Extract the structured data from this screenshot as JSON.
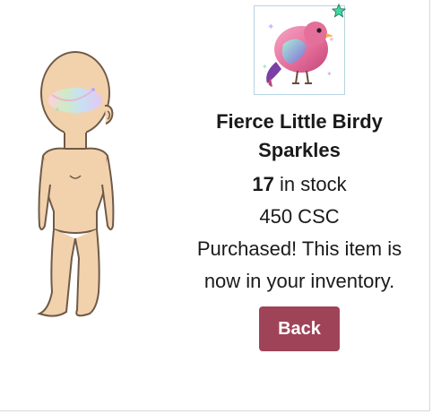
{
  "item": {
    "name": "Fierce Little Birdy Sparkles",
    "stock_count": "17",
    "stock_suffix": " in stock",
    "price": "450 CSC",
    "status": "Purchased! This item is now in your inventory.",
    "thumb_icon": "bird-sparkles-icon",
    "badge_icon": "star-icon"
  },
  "actions": {
    "back_label": "Back"
  },
  "colors": {
    "button": "#9f4458",
    "thumb_border": "#b8d3e2",
    "star": "#3fd9a1"
  }
}
